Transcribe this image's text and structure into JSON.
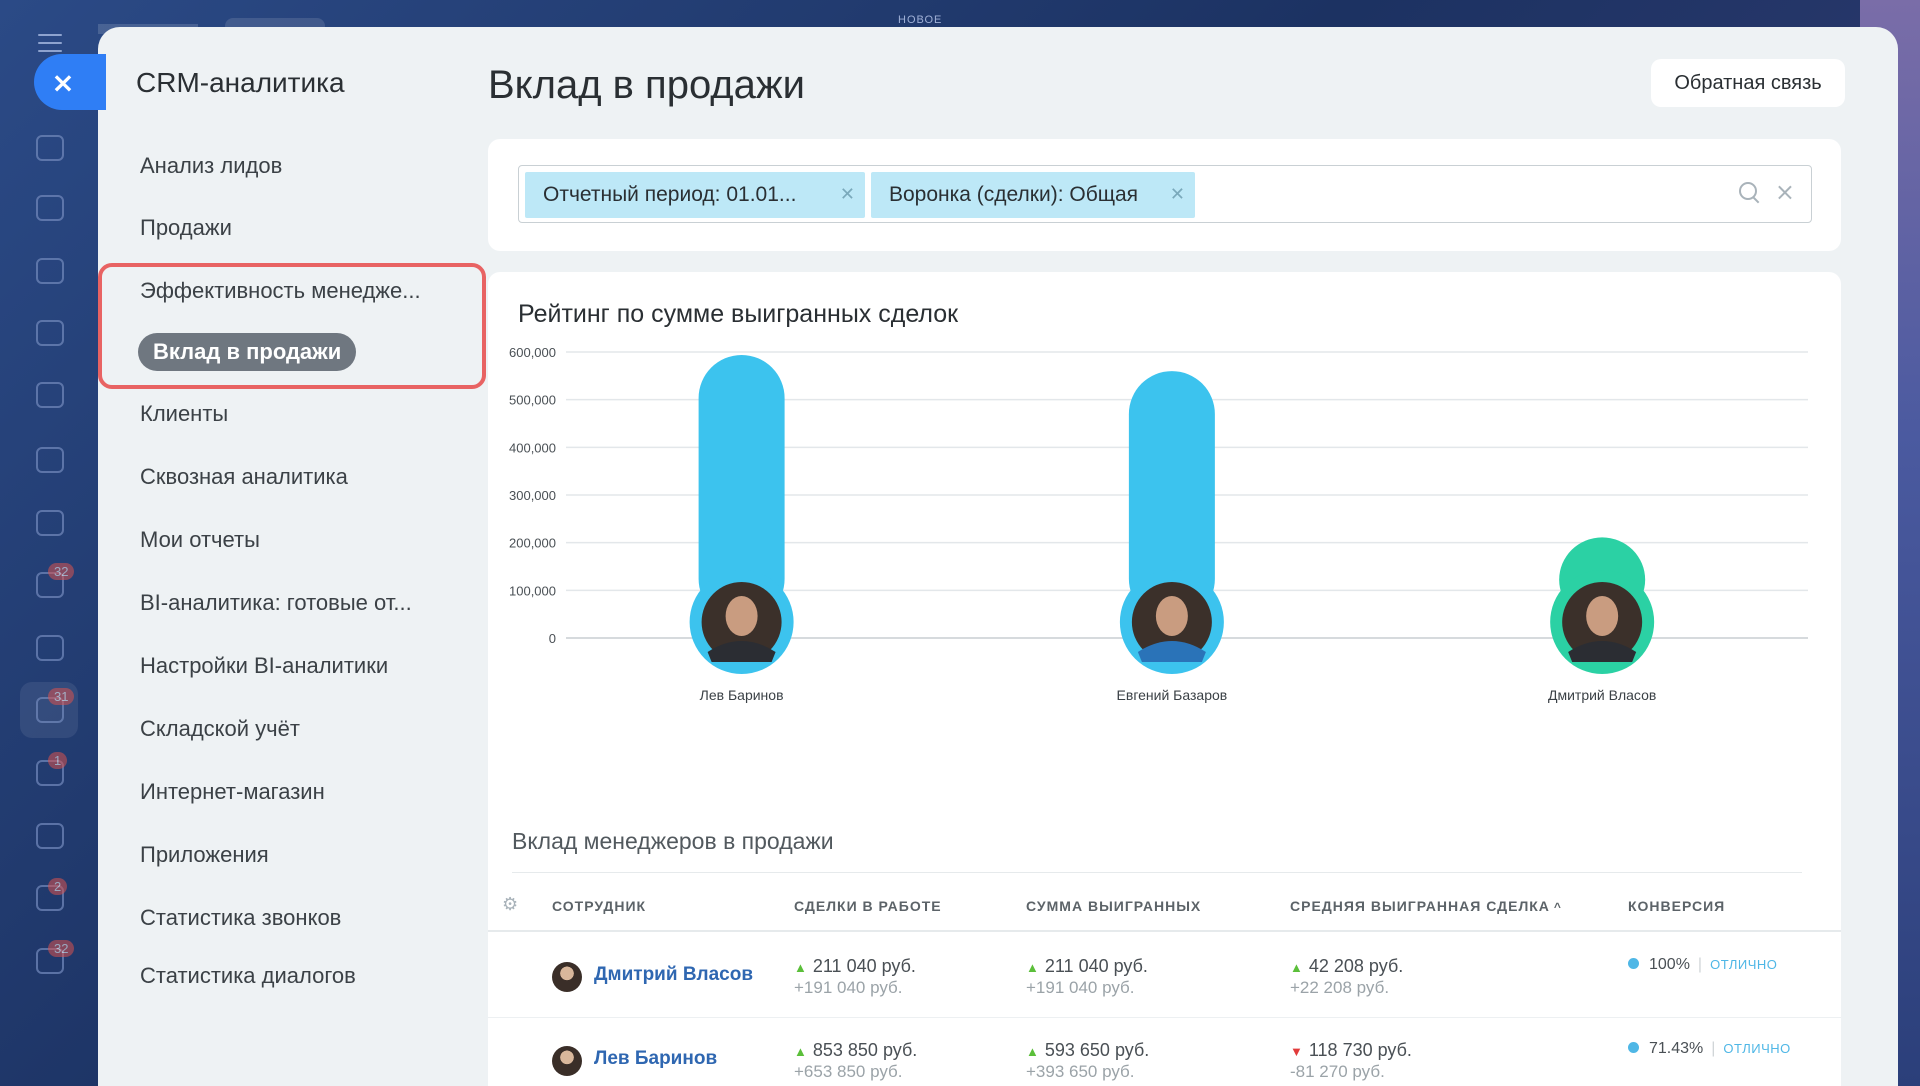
{
  "window": {
    "top_hint": "НОВОЕ"
  },
  "rail": {
    "badges": [
      {
        "icon": "tasks-icon",
        "count": "32"
      },
      {
        "icon": "crm-icon",
        "count": "31"
      },
      {
        "icon": "docs-icon",
        "count": "1"
      },
      {
        "icon": "contact-center-icon",
        "count": "2"
      },
      {
        "icon": "sites-icon",
        "count": "32"
      }
    ]
  },
  "close_button": {
    "label": "×"
  },
  "menu": {
    "title": "CRM-аналитика",
    "items": [
      {
        "label": "Анализ лидов"
      },
      {
        "label": "Продажи"
      },
      {
        "label": "Эффективность менедже..."
      },
      {
        "label": "Вклад в продажи",
        "active": true
      },
      {
        "label": "Клиенты"
      },
      {
        "label": "Сквозная аналитика"
      },
      {
        "label": "Мои отчеты"
      },
      {
        "label": "BI-аналитика: готовые от..."
      },
      {
        "label": "Настройки BI-аналитики"
      },
      {
        "label": "Складской учёт"
      },
      {
        "label": "Интернет-магазин"
      },
      {
        "label": "Приложения"
      },
      {
        "label": "Статистика звонков"
      },
      {
        "label": "Статистика диалогов"
      }
    ]
  },
  "header": {
    "title": "Вклад в продажи",
    "feedback_label": "Обратная связь"
  },
  "filter": {
    "chips": [
      {
        "label": "Отчетный период: 01.01..."
      },
      {
        "label": "Воронка (сделки): Общая"
      }
    ]
  },
  "chart_data": {
    "type": "bar",
    "title": "Рейтинг по сумме выигранных сделок",
    "categories": [
      "Лев Баринов",
      "Евгений Базаров",
      "Дмитрий Власов"
    ],
    "values": [
      593650,
      560000,
      211040
    ],
    "yticks": [
      "600,000",
      "500,000",
      "400,000",
      "300,000",
      "200,000",
      "100,000",
      "0"
    ],
    "ylim": [
      0,
      600000
    ],
    "grid": true,
    "colors": [
      "#3cc3ee",
      "#3cc3ee",
      "#2bd1a4"
    ]
  },
  "table": {
    "title": "Вклад менеджеров в продажи",
    "columns": [
      "СОТРУДНИК",
      "СДЕЛКИ В РАБОТЕ",
      "СУММА ВЫИГРАННЫХ",
      "СРЕДНЯЯ ВЫИГРАННАЯ СДЕЛКА",
      "КОНВЕРСИЯ"
    ],
    "sort_indicator": "^",
    "rows": [
      {
        "name": "Дмитрий Власов",
        "in_work": {
          "main": "211 040 руб.",
          "sub": "+191 040 руб.",
          "trend": "up"
        },
        "won_sum": {
          "main": "211 040 руб.",
          "sub": "+191 040 руб.",
          "trend": "up"
        },
        "avg_won": {
          "main": "42 208 руб.",
          "sub": "+22 208 руб.",
          "trend": "up"
        },
        "conversion": {
          "value": "100%",
          "grade": "ОТЛИЧНО"
        }
      },
      {
        "name": "Лев Баринов",
        "in_work": {
          "main": "853 850 руб.",
          "sub": "+653 850 руб.",
          "trend": "up"
        },
        "won_sum": {
          "main": "593 650 руб.",
          "sub": "+393 650 руб.",
          "trend": "up"
        },
        "avg_won": {
          "main": "118 730 руб.",
          "sub": "-81 270 руб.",
          "trend": "down"
        },
        "conversion": {
          "value": "71.43%",
          "grade": "ОТЛИЧНО"
        }
      }
    ]
  }
}
